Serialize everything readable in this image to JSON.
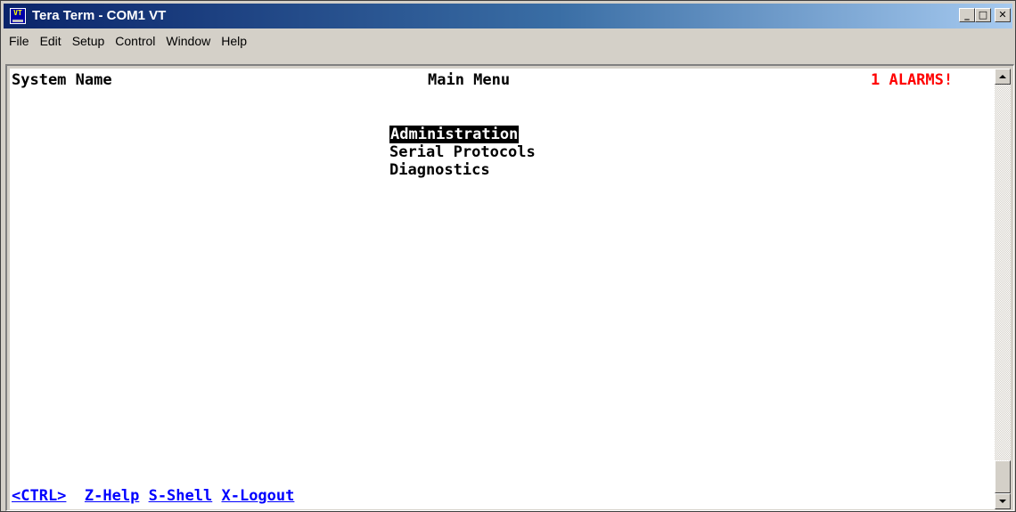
{
  "window": {
    "title": "Tera Term - COM1 VT",
    "icon": "VT"
  },
  "menubar": {
    "items": [
      "File",
      "Edit",
      "Setup",
      "Control",
      "Window",
      "Help"
    ]
  },
  "terminal": {
    "header_left": "System Name",
    "header_center": "Main Menu",
    "alarm_text": "1 ALARMS!",
    "menu": [
      "Administration",
      "Serial Protocols",
      "Diagnostics"
    ],
    "footer": {
      "ctrl": "<CTRL>",
      "help": "Z-Help",
      "shell": "S-Shell",
      "logout": "X-Logout"
    }
  },
  "colors": {
    "alarm": "#ff0000",
    "hotkeys": "#0000ff",
    "selection_bg": "#000000"
  }
}
